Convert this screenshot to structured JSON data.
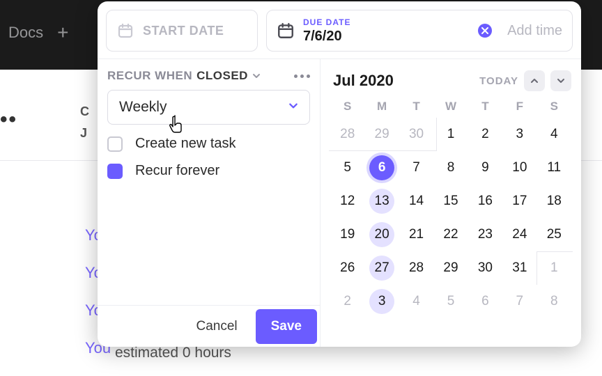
{
  "background": {
    "docs_label": "Docs",
    "plus": "+",
    "side_letter_c": "C",
    "side_letter_j": "J",
    "ellipsis": "••",
    "links": [
      "Yo",
      "Yo",
      "Yo",
      "You"
    ],
    "footline": "estimated 0 hours"
  },
  "modal": {
    "start": {
      "placeholder": "START DATE"
    },
    "due": {
      "label": "DUE DATE",
      "value": "7/6/20",
      "addtime": "Add time"
    },
    "recur": {
      "label_a": "RECUR WHEN",
      "label_b": "CLOSED",
      "frequency": "Weekly",
      "options": [
        {
          "label": "Create new task",
          "checked": false
        },
        {
          "label": "Recur forever",
          "checked": true
        }
      ]
    },
    "buttons": {
      "cancel": "Cancel",
      "save": "Save"
    },
    "calendar": {
      "month": "Jul 2020",
      "today": "TODAY",
      "dow": [
        "S",
        "M",
        "T",
        "W",
        "T",
        "F",
        "S"
      ],
      "weeks": [
        [
          {
            "n": 28,
            "muted": true
          },
          {
            "n": 29,
            "muted": true
          },
          {
            "n": 30,
            "muted": true
          },
          {
            "n": 1
          },
          {
            "n": 2
          },
          {
            "n": 3
          },
          {
            "n": 4
          }
        ],
        [
          {
            "n": 5
          },
          {
            "n": 6,
            "selected": true
          },
          {
            "n": 7
          },
          {
            "n": 8
          },
          {
            "n": 9
          },
          {
            "n": 10
          },
          {
            "n": 11
          }
        ],
        [
          {
            "n": 12
          },
          {
            "n": 13,
            "recurring": true
          },
          {
            "n": 14
          },
          {
            "n": 15
          },
          {
            "n": 16
          },
          {
            "n": 17
          },
          {
            "n": 18
          }
        ],
        [
          {
            "n": 19
          },
          {
            "n": 20,
            "recurring": true
          },
          {
            "n": 21
          },
          {
            "n": 22
          },
          {
            "n": 23
          },
          {
            "n": 24
          },
          {
            "n": 25
          }
        ],
        [
          {
            "n": 26
          },
          {
            "n": 27,
            "recurring": true
          },
          {
            "n": 28
          },
          {
            "n": 29
          },
          {
            "n": 30
          },
          {
            "n": 31
          },
          {
            "n": 1,
            "muted": true
          }
        ],
        [
          {
            "n": 2,
            "muted": true
          },
          {
            "n": 3,
            "muted": true,
            "recurring": true
          },
          {
            "n": 4,
            "muted": true
          },
          {
            "n": 5,
            "muted": true
          },
          {
            "n": 6,
            "muted": true
          },
          {
            "n": 7,
            "muted": true
          },
          {
            "n": 8,
            "muted": true
          }
        ]
      ]
    }
  }
}
